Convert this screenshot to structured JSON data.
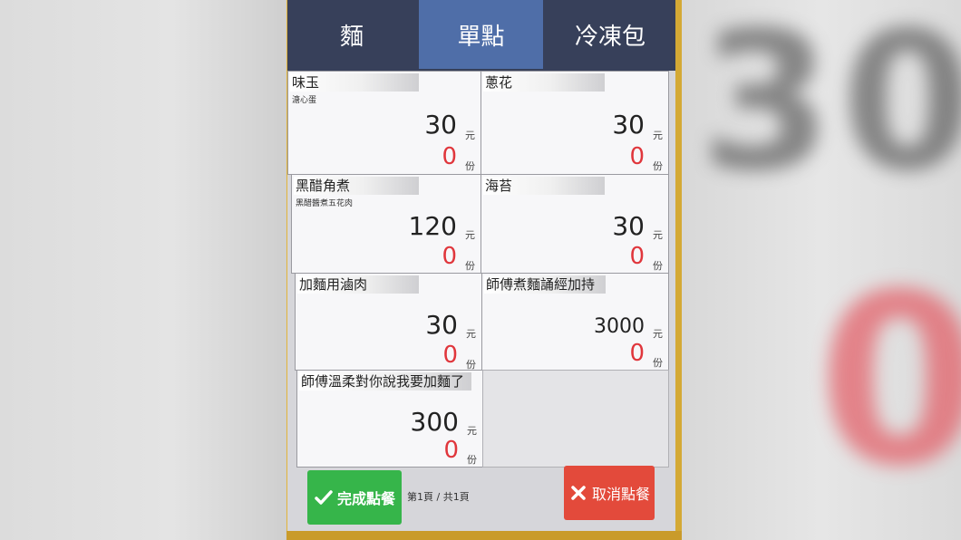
{
  "background": {
    "blur_price": "30",
    "blur_qty": "0"
  },
  "tabs": [
    {
      "label": "麵",
      "active": false
    },
    {
      "label": "單點",
      "active": true
    },
    {
      "label": "冷凍包",
      "active": false
    }
  ],
  "items": [
    {
      "name": "味玉",
      "sub": "溏心蛋",
      "price": "30",
      "price_unit": "元",
      "qty": "0",
      "qty_unit": "份"
    },
    {
      "name": "蔥花",
      "sub": "",
      "price": "30",
      "price_unit": "元",
      "qty": "0",
      "qty_unit": "份"
    },
    {
      "name": "黑醋角煮",
      "sub": "黑醋醬煮五花肉",
      "price": "120",
      "price_unit": "元",
      "qty": "0",
      "qty_unit": "份"
    },
    {
      "name": "海苔",
      "sub": "",
      "price": "30",
      "price_unit": "元",
      "qty": "0",
      "qty_unit": "份"
    },
    {
      "name": "加麵用滷肉",
      "sub": "",
      "price": "30",
      "price_unit": "元",
      "qty": "0",
      "qty_unit": "份"
    },
    {
      "name": "師傅煮麵誦經加持",
      "sub": "",
      "price": "3000",
      "price_unit": "元",
      "qty": "0",
      "qty_unit": "份"
    },
    {
      "name": "師傅溫柔對你說我要加麵了",
      "sub": "",
      "price": "300",
      "price_unit": "元",
      "qty": "0",
      "qty_unit": "份"
    }
  ],
  "footer": {
    "confirm_label": "完成點餐",
    "page_info": "第1頁 / 共1頁",
    "cancel_label": "取消點餐"
  },
  "colors": {
    "tab_bar": "#37405a",
    "tab_active": "#4f6ea8",
    "confirm": "#36b54a",
    "cancel": "#e34a3b",
    "qty_red": "#e0363c",
    "frame": "#e3b53a"
  }
}
